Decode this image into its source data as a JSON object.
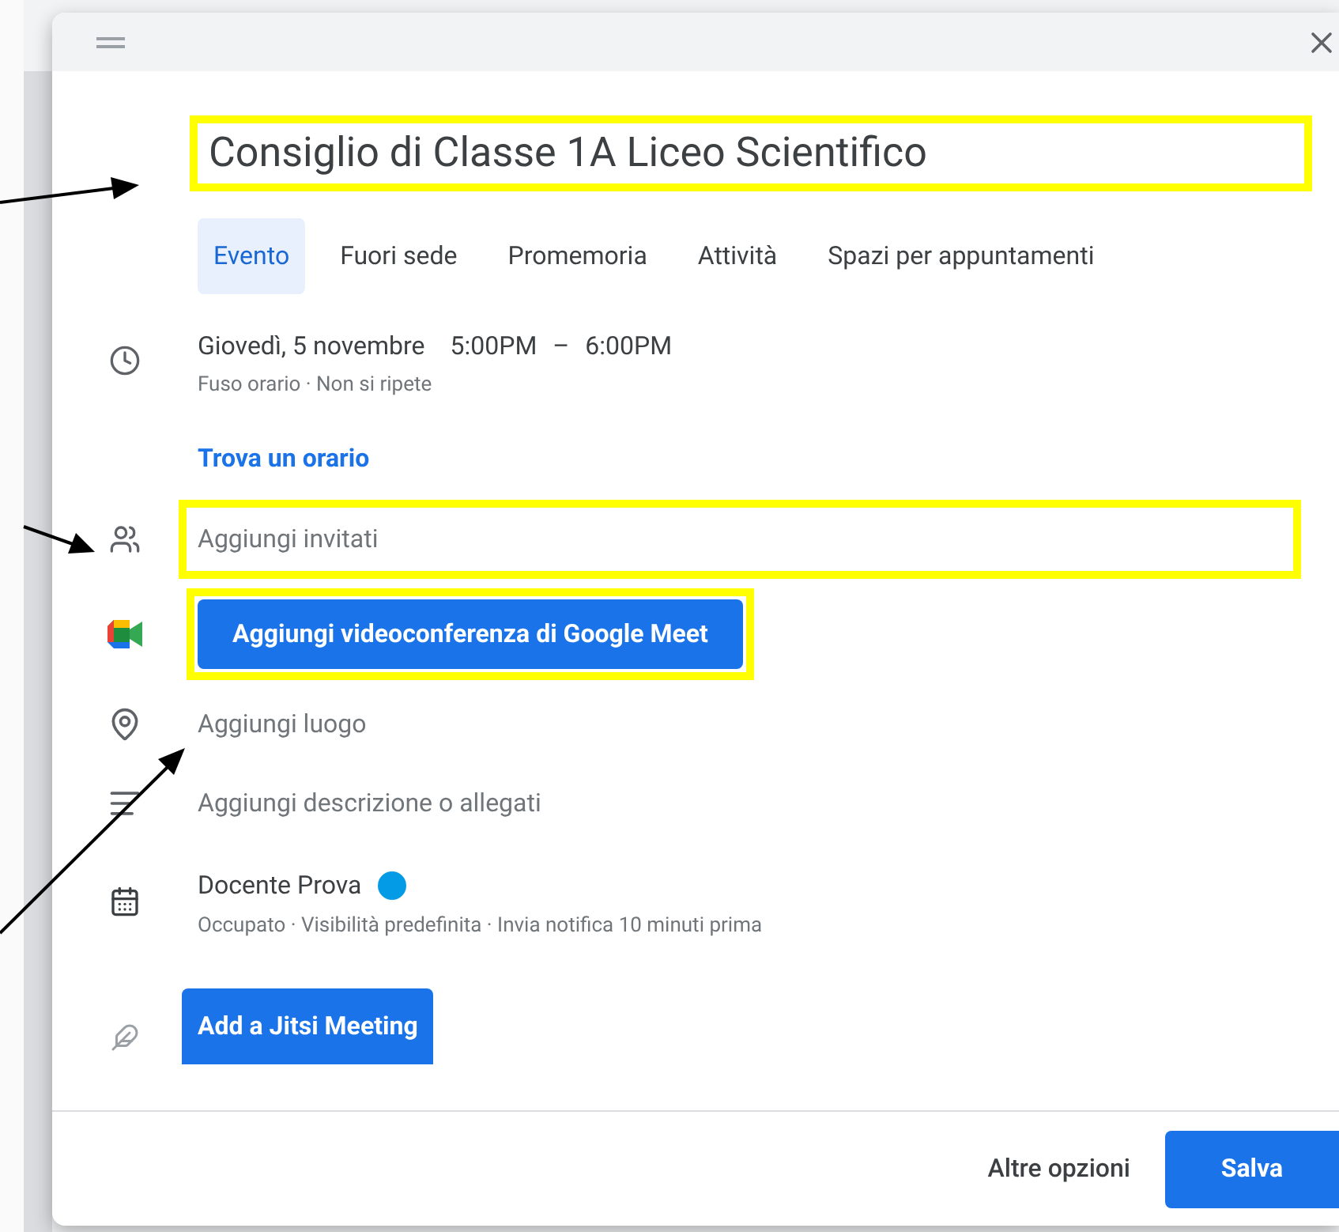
{
  "dialog": {
    "title_field": {
      "value": "Consiglio di Classe 1A Liceo Scientifico",
      "highlighted": true
    },
    "tabs": [
      {
        "label": "Evento",
        "selected": true
      },
      {
        "label": "Fuori sede",
        "selected": false
      },
      {
        "label": "Promemoria",
        "selected": false
      },
      {
        "label": "Attività",
        "selected": false
      },
      {
        "label": "Spazi per appuntamenti",
        "selected": false
      }
    ],
    "rows": [
      {
        "kind": "time",
        "date": "Giovedì, 5 novembre",
        "start": "5:00PM",
        "dash": "–",
        "end": "6:00PM",
        "details": "Fuso orario · Non si ripete",
        "link": "Trova un orario"
      },
      {
        "kind": "guests",
        "placeholder": "Aggiungi invitati",
        "highlighted": true
      },
      {
        "kind": "meet",
        "button": "Aggiungi videoconferenza di Google Meet",
        "highlighted": true
      },
      {
        "kind": "location",
        "placeholder": "Aggiungi luogo"
      },
      {
        "kind": "description",
        "placeholder": "Aggiungi descrizione o allegati"
      },
      {
        "kind": "calendar",
        "name": "Docente Prova",
        "color": "#039be5",
        "details": "Occupato · Visibilità predefinita · Invia notifica 10 minuti prima"
      },
      {
        "kind": "jitsi",
        "button": "Add a Jitsi Meeting"
      }
    ],
    "footer": {
      "more": "Altre opzioni",
      "save": "Salva"
    }
  }
}
